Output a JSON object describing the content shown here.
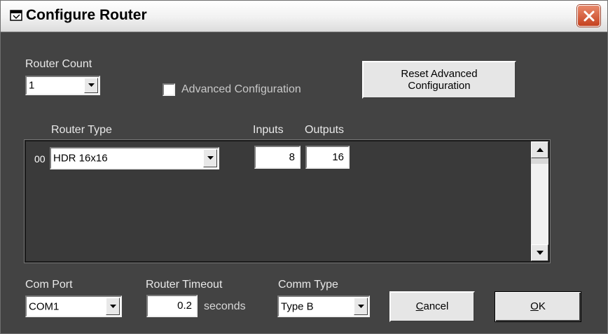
{
  "window": {
    "title": "Configure Router"
  },
  "router_count": {
    "label": "Router Count",
    "value": "1"
  },
  "advanced": {
    "label": "Advanced Configuration",
    "checked": false
  },
  "reset_button": {
    "line1": "Reset Advanced",
    "line2": "Configuration"
  },
  "columns": {
    "router_type": "Router Type",
    "inputs": "Inputs",
    "outputs": "Outputs"
  },
  "routers": [
    {
      "index": "00",
      "type": "HDR 16x16",
      "inputs": "8",
      "outputs": "16"
    }
  ],
  "com_port": {
    "label": "Com Port",
    "value": "COM1"
  },
  "router_timeout": {
    "label": "Router Timeout",
    "value": "0.2",
    "unit": "seconds"
  },
  "comm_type": {
    "label": "Comm Type",
    "value": "Type B"
  },
  "buttons": {
    "cancel_hotkey": "C",
    "cancel_rest": "ancel",
    "ok_hotkey": "O",
    "ok_rest": "K"
  },
  "icons": {
    "title": "window-app-icon",
    "close": "close-icon",
    "dropdown": "chevron-down-icon",
    "scroll_up": "scroll-up-icon",
    "scroll_down": "scroll-down-icon"
  },
  "colors": {
    "close_button": "#d0522f",
    "background": "#434343"
  }
}
